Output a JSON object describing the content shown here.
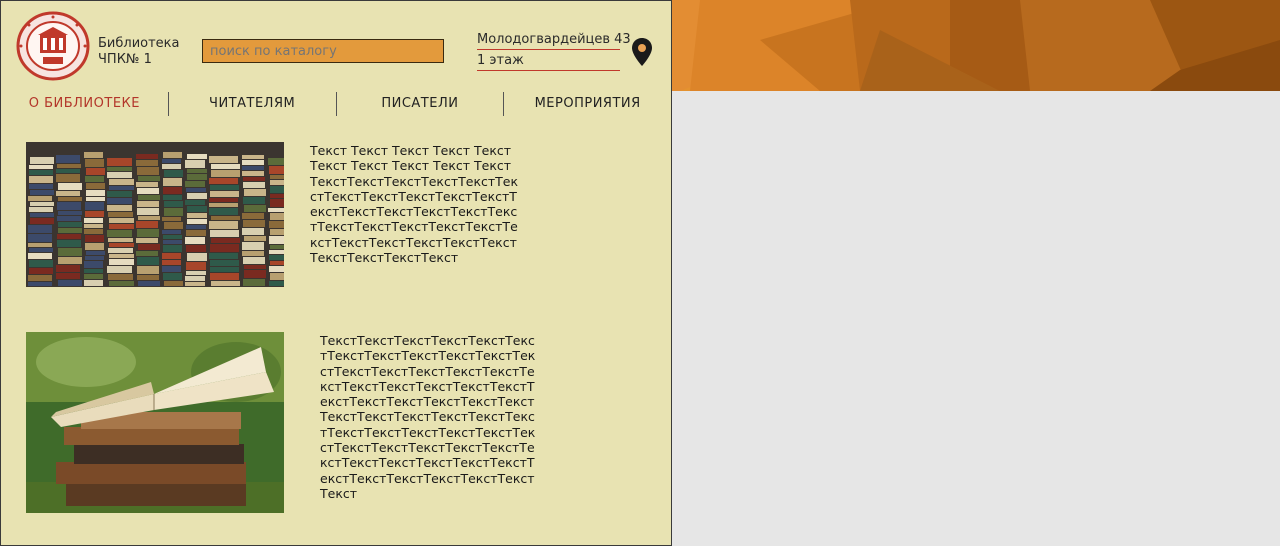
{
  "header": {
    "logo_text": "ЧЕЛЯБИНСКИЙ ПЕДАГОГИЧЕСКИЙ КОЛЛЕДЖ №1",
    "logo_bottom": "ЧПК№1",
    "library_name_line1": "Библиотека",
    "library_name_line2": "ЧПК№ 1",
    "search_placeholder": "поиск по каталогу",
    "address_line1": "Молодогвардейцев 43",
    "address_line2": "1 этаж"
  },
  "nav": {
    "items": [
      {
        "label": "О библиотеке",
        "active": true
      },
      {
        "label": "Читателям",
        "active": false
      },
      {
        "label": "Писатели",
        "active": false
      },
      {
        "label": "Мероприятия",
        "active": false
      }
    ]
  },
  "content": {
    "text1": "Текст Текст Текст Текст Текст Текст Текст Текст Текст Текст ТекстТекстТекстТекстТекстТекстТекстТекстТекстТекстТекстТекстТекстТекстТекстТекстТекстТекстТекстТекстТекстТекстТекстТекстТекстТекстТекстТекстТекстТекстТекстТекст",
    "text2": "ТекстТекстТекстТекстТекстТекстТекстТекстТекстТекстТекстТекстТекстТекстТекстТекстТекстТекстТекстТекстТекстТекстТекстТекстТекстТекстТекстТекстТекстТекстТекстТекстТекстТекстТекстТекстТекстТекстТекстТекстТекстТекстТекстТекстТекстТекстТекстТекстТекстТекстТекстТекстТекстТекстТекстТекстТекстТекстТекст"
  },
  "colors": {
    "page_background": "#e8e3b2",
    "active_nav": "#b3362a",
    "search_field": "#e39a3c",
    "banner_orange": "#e08a2e",
    "outside_background": "#e6e6e6"
  },
  "icons": {
    "location": "map-pin-icon"
  }
}
